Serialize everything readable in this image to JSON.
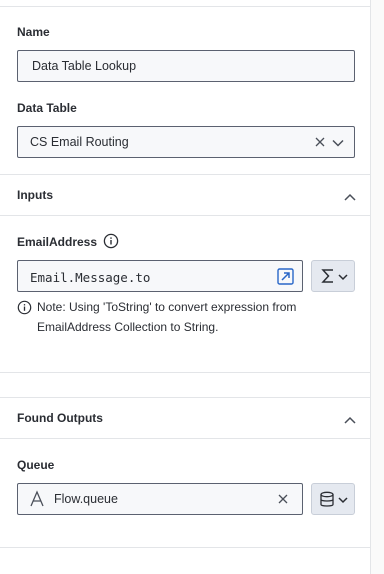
{
  "name": {
    "label": "Name",
    "value": "Data Table Lookup"
  },
  "data_table": {
    "label": "Data Table",
    "value": "CS Email Routing"
  },
  "inputs": {
    "title": "Inputs",
    "email_label": "EmailAddress",
    "email_value": "Email.Message.to",
    "note": "Note: Using 'ToString' to convert expression from EmailAddress Collection to String."
  },
  "found_outputs": {
    "title": "Found Outputs",
    "queue_label": "Queue",
    "queue_value": "Flow.queue"
  },
  "colors": {
    "accent": "#2866c8",
    "border": "#5b6170",
    "button_bg": "#e5e9f0"
  }
}
